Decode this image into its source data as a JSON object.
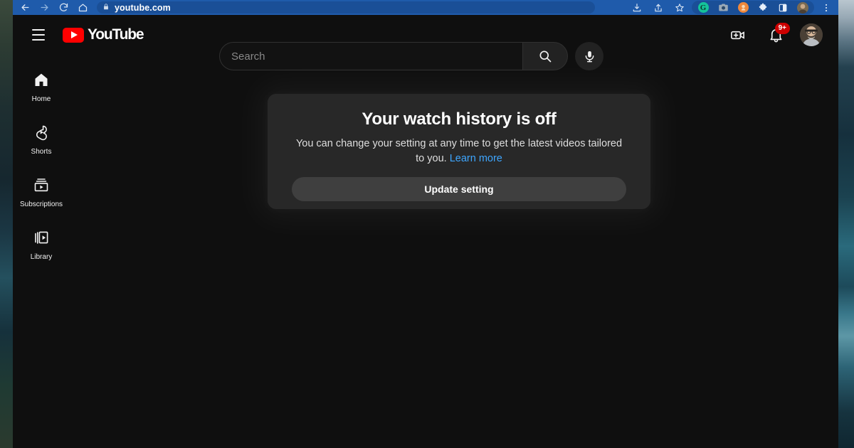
{
  "browser": {
    "url": "youtube.com",
    "nav": {
      "back": "back-arrow",
      "forward": "forward-arrow",
      "reload": "reload",
      "home": "home"
    },
    "lock_icon": "lock-icon",
    "toolbar_icons": [
      {
        "name": "install-app-icon",
        "label": "Install"
      },
      {
        "name": "share-icon",
        "label": "Share"
      },
      {
        "name": "bookmark-star-icon",
        "label": "Bookmark"
      },
      {
        "name": "grammarly-extension-icon",
        "label": "G",
        "color": "#15c39a"
      },
      {
        "name": "screenshot-extension-icon",
        "label": "Camera",
        "color": "#8a9aa8"
      },
      {
        "name": "honey-extension-icon",
        "label": "Honey",
        "color": "#f0883b"
      },
      {
        "name": "extensions-puzzle-icon",
        "label": "Extensions"
      },
      {
        "name": "side-panel-icon",
        "label": "Side panel"
      },
      {
        "name": "browser-profile-avatar",
        "label": "Profile"
      },
      {
        "name": "chrome-menu-icon",
        "label": "More"
      }
    ]
  },
  "header": {
    "menu_label": "Guide",
    "logo_text": "YouTube",
    "search": {
      "placeholder": "Search",
      "value": "",
      "search_button_label": "Search",
      "mic_button_label": "Search with your voice"
    },
    "create_label": "Create",
    "notifications_label": "Notifications",
    "notifications_count": "9+",
    "avatar_label": "Account"
  },
  "sidebar": {
    "items": [
      {
        "label": "Home",
        "icon": "home-icon",
        "active": true
      },
      {
        "label": "Shorts",
        "icon": "shorts-icon",
        "active": false
      },
      {
        "label": "Subscriptions",
        "icon": "subscriptions-icon",
        "active": false
      },
      {
        "label": "Library",
        "icon": "library-icon",
        "active": false
      }
    ]
  },
  "card": {
    "title": "Your watch history is off",
    "description_1": "You can change your setting at any time to get the latest videos tailored to you.",
    "link_text": "Learn more",
    "button_label": "Update setting"
  },
  "colors": {
    "page_background": "#0f0f0f",
    "card_background": "#282828",
    "button_background": "#3f3f3f",
    "link_blue": "#3ea6ff",
    "youtube_red": "#ff0000",
    "badge_red": "#cc0000",
    "browser_chrome_blue": "#1f5bab"
  }
}
